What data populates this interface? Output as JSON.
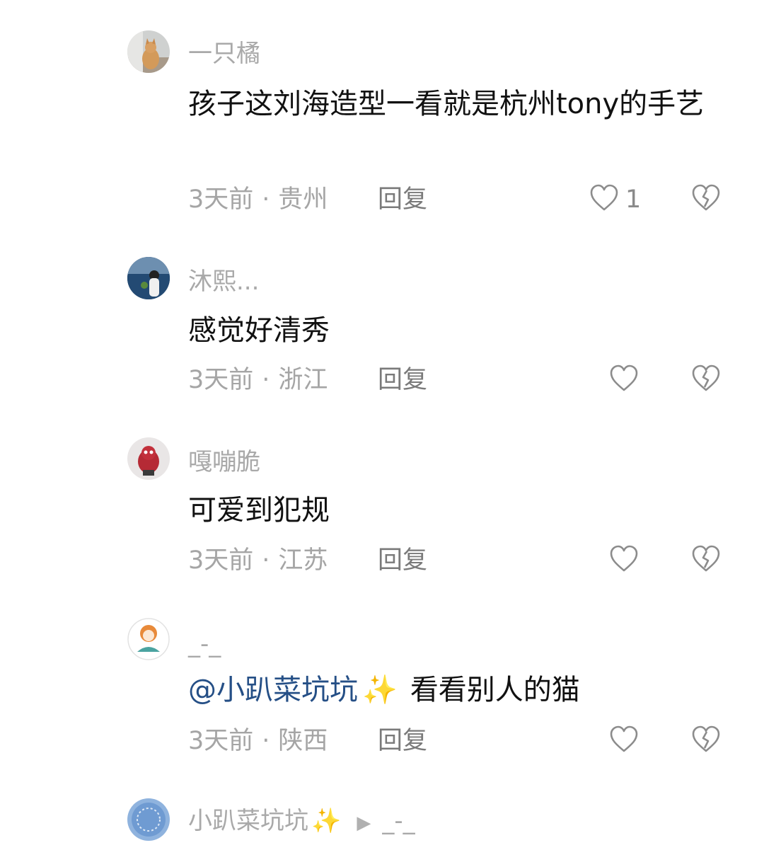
{
  "comments": [
    {
      "username": "一只橘",
      "content": "孩子这刘海造型一看就是杭州tony的手艺",
      "time": "3天前",
      "region": "贵州",
      "reply_label": "回复",
      "like_count": "1",
      "avatar_icon": "orange-cat-avatar"
    },
    {
      "username": "沐熙...",
      "content": "感觉好清秀",
      "time": "3天前",
      "region": "浙江",
      "reply_label": "回复",
      "like_count": "",
      "avatar_icon": "girl-seaside-avatar"
    },
    {
      "username": "嘎嘣脆",
      "content": "可爱到犯规",
      "time": "3天前",
      "region": "江苏",
      "reply_label": "回复",
      "like_count": "",
      "avatar_icon": "red-character-avatar"
    },
    {
      "username": "_-_",
      "mention": "@小趴菜坑坑",
      "mention_emoji": "✨",
      "content": "看看别人的猫",
      "time": "3天前",
      "region": "陕西",
      "reply_label": "回复",
      "like_count": "",
      "avatar_icon": "cartoon-girl-avatar"
    },
    {
      "username": "小趴菜坑坑",
      "username_emoji": "✨",
      "reply_to_arrow": "▶",
      "reply_to": "_-_",
      "avatar_icon": "blue-circle-avatar"
    }
  ],
  "meta_separator": "·",
  "colors": {
    "text_primary": "#111111",
    "text_secondary": "#a5a5a5",
    "mention": "#254f86",
    "icon_stroke": "#8c8c8c"
  }
}
